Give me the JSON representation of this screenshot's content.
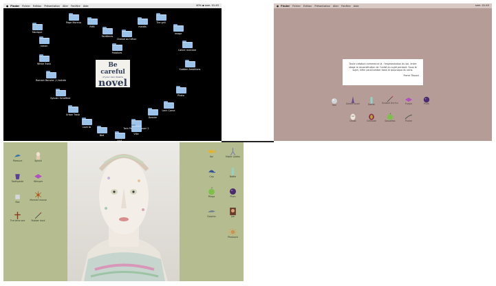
{
  "finder_shot": {
    "menubar": {
      "apple": "",
      "app": "Finder",
      "items": [
        "Fichier",
        "Edition",
        "Présentation",
        "Aller",
        "Fenêtre",
        "Aide"
      ],
      "status": "40% ▪ sam. 01:45"
    },
    "folders": [
      {
        "label": "Pepe Moreno"
      },
      {
        "label": "Fabrique"
      },
      {
        "label": "RHB"
      },
      {
        "label": "Fantômes"
      },
      {
        "label": "Chasse au trésor"
      },
      {
        "label": "mardis"
      },
      {
        "label": "The grill"
      },
      {
        "label": "image"
      },
      {
        "label": "roman"
      },
      {
        "label": "Cahier membre"
      },
      {
        "label": "Potatoes"
      },
      {
        "label": "White Trash"
      },
      {
        "label": "Sudden Ambitions"
      },
      {
        "label": "Romain Bouvier / L'entrée"
      },
      {
        "label": "Photo"
      },
      {
        "label": "Sylvain Scheffner"
      },
      {
        "label": "Lech Carne"
      },
      {
        "label": "Urban Trash"
      },
      {
        "label": "Dossier"
      },
      {
        "label": "Twin Peaks - Season 2"
      },
      {
        "label": "Love to"
      },
      {
        "label": "Bed"
      },
      {
        "label": "AAA"
      },
      {
        "label": "Ville"
      }
    ],
    "book": {
      "line1": "Be careful",
      "line2": "of your own dreams",
      "line3": "novel"
    }
  },
  "quote_shot": {
    "menubar": {
      "apple": "",
      "app": "Finder",
      "items": [
        "Fichier",
        "Edition",
        "Présentation",
        "Aller",
        "Fenêtre",
        "Aide"
      ],
      "status": "sam. 01:45"
    },
    "quote": {
      "text": "Toute création commence là : fragmentation du soi, entre stage la reconstitution de l'unité du sujet perdant. Sous le sujet, infini peut-tomber dans le quiproquo du sens.",
      "author": "Pierre Tibozzi"
    },
    "icons": [
      {
        "label": "Kiki",
        "kind": "sphere-grey"
      },
      {
        "label": "Gentle touch",
        "kind": "figure-purple"
      },
      {
        "label": "Bottle",
        "kind": "bottle-teal"
      },
      {
        "label": "Scratch the fur",
        "kind": "needle"
      },
      {
        "label": "Purple",
        "kind": "flat-purple"
      },
      {
        "label": "Plum",
        "kind": "sphere-plum"
      },
      {
        "label": "Ghost",
        "kind": "head-pale"
      },
      {
        "label": "Grenade",
        "kind": "mask-red"
      },
      {
        "label": "Sassafras",
        "kind": "fruit-green"
      },
      {
        "label": "Plume",
        "kind": "feather"
      }
    ]
  },
  "sculpture_shot": {
    "left_items": [
      {
        "label": "Pleasure",
        "kind": "bird-blue"
      },
      {
        "label": "Sprout",
        "kind": "figurine"
      },
      {
        "label": "Toothpaste",
        "kind": "cup-purple"
      },
      {
        "label": "Whisper",
        "kind": "flat-purple"
      },
      {
        "label": "Box",
        "kind": "cube-grey"
      },
      {
        "label": "Monster mouse",
        "kind": "spider-orange"
      },
      {
        "label": "The lame one",
        "kind": "figure-brown"
      },
      {
        "label": "Rubber duck",
        "kind": "needle"
      }
    ],
    "right_items": [
      {
        "label": "Koi",
        "kind": "fish-yellow"
      },
      {
        "label": "Mister Ladies",
        "kind": "tripod"
      },
      {
        "label": "Cap",
        "kind": "cap-blue"
      },
      {
        "label": "Bottle",
        "kind": "bottle-teal"
      },
      {
        "label": "Pitaya",
        "kind": "fruit-green"
      },
      {
        "label": "Plum",
        "kind": "sphere-plum"
      },
      {
        "label": "Dolphin",
        "kind": "dolphin"
      },
      {
        "label": "Joe",
        "kind": "portrait"
      },
      {
        "label": "Pheasant",
        "kind": "burst"
      }
    ]
  }
}
